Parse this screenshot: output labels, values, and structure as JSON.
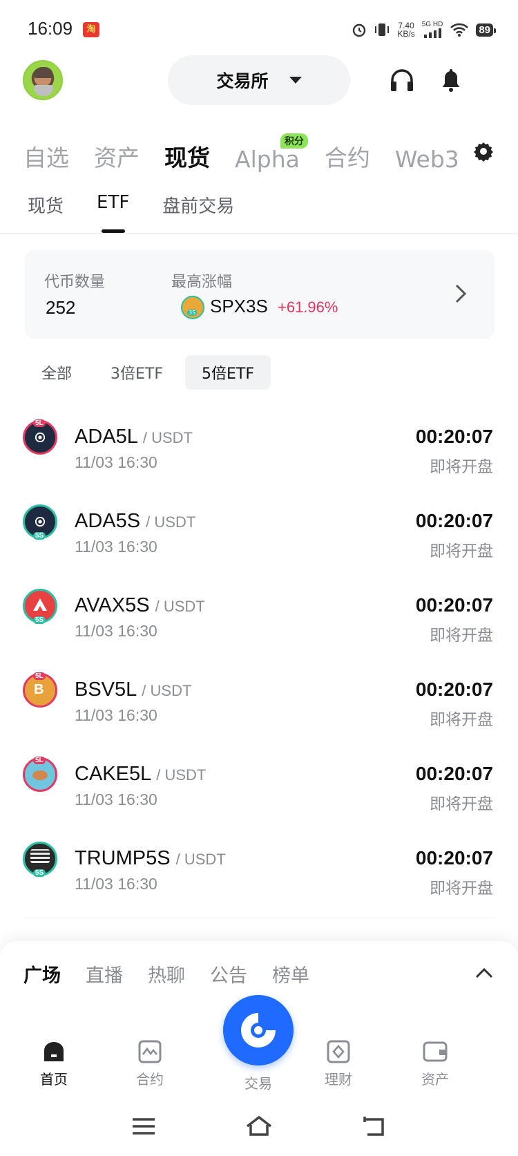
{
  "status_bar": {
    "time": "16:09",
    "app_badge": "淘",
    "speed_value": "7.40",
    "speed_unit": "KB/s",
    "network": "5G HD",
    "battery": "89"
  },
  "header": {
    "exchange_label": "交易所"
  },
  "main_tabs": [
    {
      "label": "自选"
    },
    {
      "label": "资产"
    },
    {
      "label": "现货"
    },
    {
      "label": "Alpha",
      "badge": "积分"
    },
    {
      "label": "合约"
    },
    {
      "label": "Web3"
    }
  ],
  "sub_tabs": [
    {
      "label": "现货"
    },
    {
      "label": "ETF"
    },
    {
      "label": "盘前交易"
    }
  ],
  "summary": {
    "count_label": "代币数量",
    "count_value": "252",
    "top_gain_label": "最高涨幅",
    "top_gain_symbol": "SPX3S",
    "top_gain_pct": "+61.96%"
  },
  "filters": [
    {
      "label": "全部"
    },
    {
      "label": "3倍ETF"
    },
    {
      "label": "5倍ETF"
    }
  ],
  "listings": [
    {
      "symbol": "ADA5L",
      "quote": "/ USDT",
      "date": "11/03 16:30",
      "countdown": "00:20:07",
      "status": "即将开盘",
      "tag": "5L"
    },
    {
      "symbol": "ADA5S",
      "quote": "/ USDT",
      "date": "11/03 16:30",
      "countdown": "00:20:07",
      "status": "即将开盘",
      "tag": "5S"
    },
    {
      "symbol": "AVAX5S",
      "quote": "/ USDT",
      "date": "11/03 16:30",
      "countdown": "00:20:07",
      "status": "即将开盘",
      "tag": "5S"
    },
    {
      "symbol": "BSV5L",
      "quote": "/ USDT",
      "date": "11/03 16:30",
      "countdown": "00:20:07",
      "status": "即将开盘",
      "tag": "5L"
    },
    {
      "symbol": "CAKE5L",
      "quote": "/ USDT",
      "date": "11/03 16:30",
      "countdown": "00:20:07",
      "status": "即将开盘",
      "tag": "5L"
    },
    {
      "symbol": "TRUMP5S",
      "quote": "/ USDT",
      "date": "11/03 16:30",
      "countdown": "00:20:07",
      "status": "即将开盘",
      "tag": "5S"
    }
  ],
  "sheet_tabs": [
    {
      "label": "广场"
    },
    {
      "label": "直播"
    },
    {
      "label": "热聊"
    },
    {
      "label": "公告"
    },
    {
      "label": "榜单"
    }
  ],
  "bottom_nav": {
    "home": "首页",
    "futures": "合约",
    "trade": "交易",
    "earn": "理财",
    "assets": "资产"
  },
  "colors": {
    "accent_blue": "#1f6bff",
    "gain_red": "#e2365c",
    "long_tag": "#e23a60",
    "short_tag": "#2bbfa4",
    "badge_green": "#8fe35a"
  }
}
